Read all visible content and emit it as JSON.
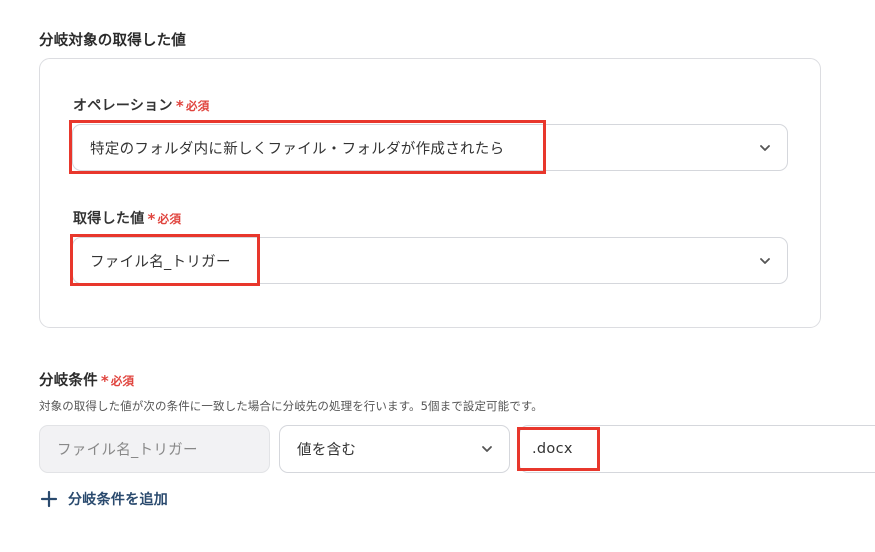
{
  "branch_target": {
    "title": "分岐対象の取得した値",
    "operation": {
      "label": "オペレーション",
      "required": "必須",
      "value": "特定のフォルダ内に新しくファイル・フォルダが作成されたら"
    },
    "acquired_value": {
      "label": "取得した値",
      "required": "必須",
      "value": "ファイル名_トリガー"
    }
  },
  "branch_condition": {
    "title": "分岐条件",
    "required": "必須",
    "helper": "対象の取得した値が次の条件に一致した場合に分岐先の処理を行います。5個まで設定可能です。",
    "condition": {
      "field": "ファイル名_トリガー",
      "operator": "値を含む",
      "value": ".docx"
    },
    "add_label": "分岐条件を追加"
  },
  "colors": {
    "required": "#e0443e",
    "highlight": "#e8372c",
    "link": "#2a4a6e",
    "disabled_bg": "#f2f2f4"
  },
  "icons": [
    "chevron-down-icon",
    "plus-icon",
    "required-asterisk-icon"
  ]
}
